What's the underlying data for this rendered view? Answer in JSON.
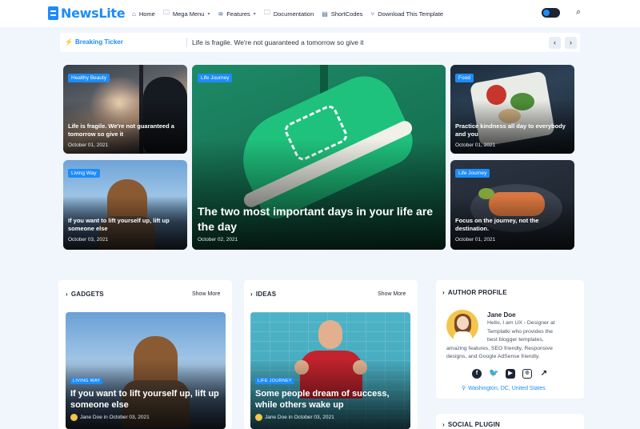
{
  "header": {
    "logo": "NewsLite",
    "nav": [
      {
        "label": "Home",
        "icon": "home-icon"
      },
      {
        "label": "Mega Menu",
        "icon": "folder-icon",
        "dropdown": true
      },
      {
        "label": "Features",
        "icon": "layers-icon",
        "dropdown": true
      },
      {
        "label": "Documentation",
        "icon": "folder-icon"
      },
      {
        "label": "ShortCodes",
        "icon": "code-icon"
      },
      {
        "label": "Download This Template",
        "icon": "branch-icon"
      }
    ]
  },
  "ticker": {
    "label": "Breaking Ticker",
    "text": "Life is fragile. We're not guaranteed a tomorrow so give it"
  },
  "featured": [
    {
      "tag": "Healthy Beauty",
      "title": "Life is fragile. We're not guaranteed a tomorrow so give it",
      "date": "October 01, 2021"
    },
    {
      "tag": "Life Journey",
      "title": "The two most important days in your life are the day",
      "date": "October 02, 2021"
    },
    {
      "tag": "Food",
      "title": "Practice kindness all day to everybody and you",
      "date": "October 01, 2021"
    },
    {
      "tag": "Living Way",
      "title": "If you want to lift yourself up, lift up someone else",
      "date": "October 03, 2021"
    },
    {
      "tag": "Life Journey",
      "title": "Focus on the journey, not the destination.",
      "date": "October 01, 2021"
    }
  ],
  "gadgets": {
    "heading": "GADGETS",
    "show_more": "Show More",
    "post": {
      "tag": "LIVING WAY",
      "title": "If you want to lift yourself up, lift up someone else",
      "meta": "Jane Doe in October 03, 2021"
    }
  },
  "ideas": {
    "heading": "IDEAS",
    "show_more": "Show More",
    "post": {
      "tag": "LIFE JOURNEY",
      "title": "Some people dream of success, while others wake up",
      "meta": "Jane Doe in October 03, 2021"
    }
  },
  "author": {
    "heading": "AUTHOR PROFILE",
    "name": "Jane Doe",
    "bio_lines": [
      "Hello, I am UX - Designer at",
      "Templatki who provides the",
      "best blogger templates,"
    ],
    "bio_rest": "amazing features, SEO friendly, Responsive designs, and Google AdSense friendly.",
    "location": "Washington, DC, United States",
    "socials": [
      "facebook-icon",
      "twitter-icon",
      "youtube-icon",
      "instagram-icon",
      "external-link-icon"
    ]
  },
  "social_plugin": {
    "heading": "SOCIAL PLUGIN"
  },
  "colors": {
    "accent": "#1d8cf8",
    "dark": "#1d2433",
    "page_bg": "#f0f6fb"
  }
}
